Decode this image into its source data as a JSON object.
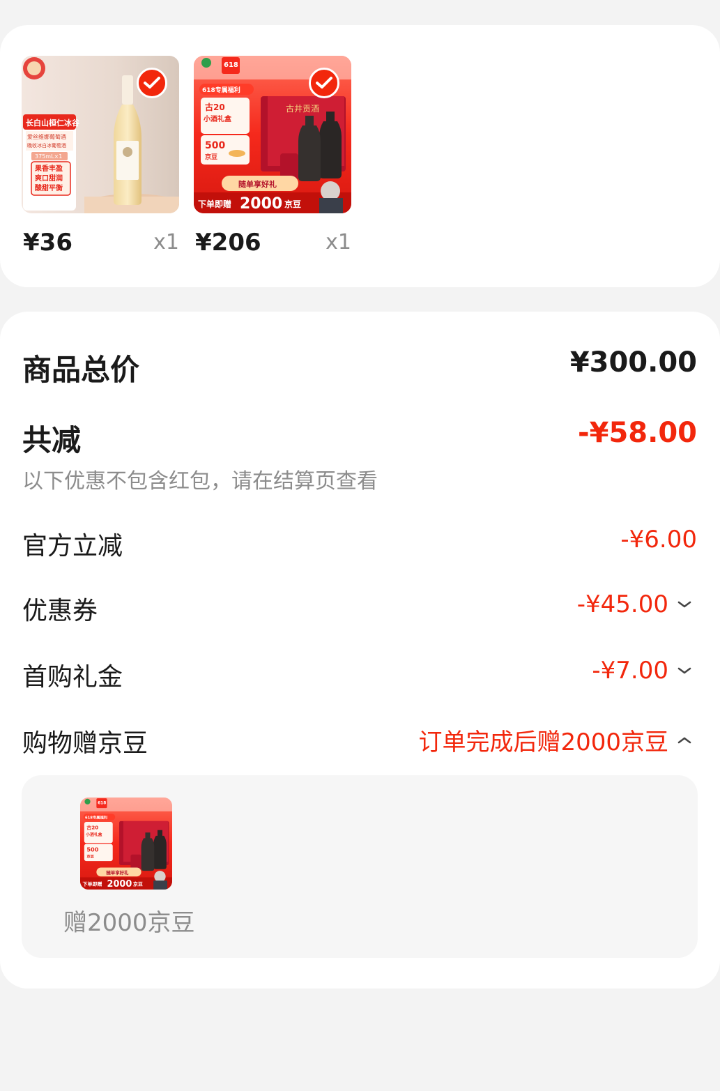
{
  "colors": {
    "accent": "#f2270c",
    "page_background": "#f3f3f3",
    "card_background": "#ffffff",
    "muted_text": "#8c8c8c"
  },
  "products": [
    {
      "image_icon": "ice-wine-bottle-image",
      "image_texts": [
        "长白山桓仁冰谷",
        "爱丝维娜葡萄酒",
        "晚收冰白冰葡萄酒",
        "375mL×1",
        "果香丰盈",
        "爽口甜润",
        "酸甜平衡"
      ],
      "price": "¥36",
      "qty": "x1",
      "selected": true
    },
    {
      "image_icon": "liquor-gift-box-image",
      "image_texts": [
        "618",
        "618专属福利",
        "古20",
        "小酒礼盒",
        "500",
        "京豆",
        "随单享好礼",
        "下单即赠",
        "2000",
        "京豆",
        "古井贡酒"
      ],
      "price": "¥206",
      "qty": "x1",
      "selected": true
    }
  ],
  "summary": {
    "total_label": "商品总价",
    "total_value": "¥300.00",
    "reduce_label": "共减",
    "reduce_value": "-¥58.00",
    "reduce_note": "以下优惠不包含红包，请在结算页查看",
    "rows": [
      {
        "label": "官方立减",
        "value": "-¥6.00"
      },
      {
        "label": "优惠券",
        "value": "-¥45.00"
      },
      {
        "label": "首购礼金",
        "value": "-¥7.00"
      },
      {
        "label": "购物赠京豆",
        "value": "订单完成后赠2000京豆"
      }
    ],
    "gift": {
      "image_texts": [
        "618",
        "618专属福利",
        "古20",
        "小酒礼盒",
        "500",
        "京豆",
        "随单享好礼",
        "下单即赠",
        "2000",
        "京豆"
      ],
      "caption": "赠2000京豆"
    }
  }
}
